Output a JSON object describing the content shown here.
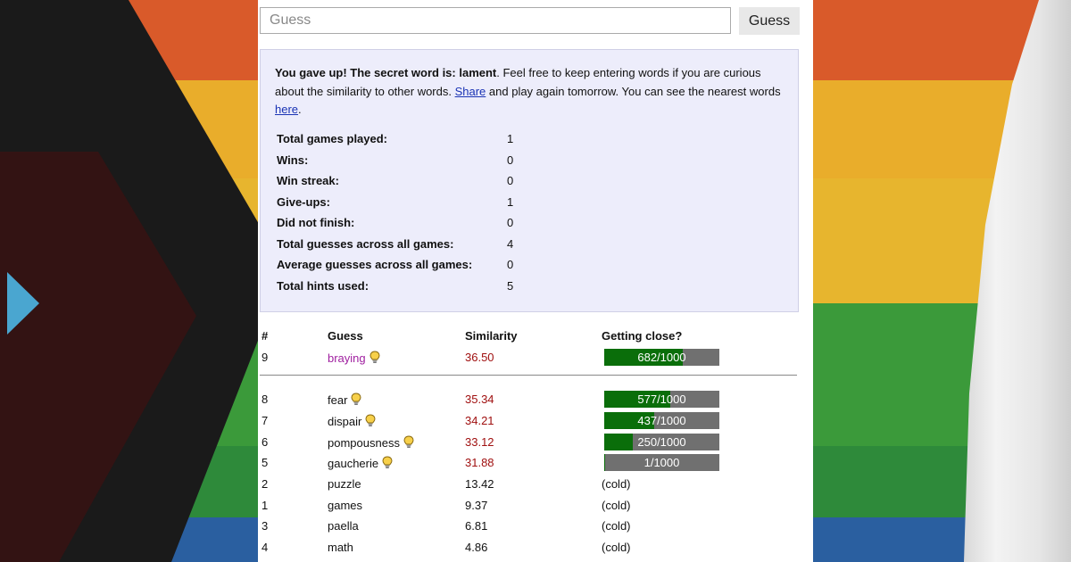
{
  "guess": {
    "placeholder": "Guess",
    "button": "Guess"
  },
  "result": {
    "gave_up_bold": "You gave up! The secret word is: lament",
    "text_1": ". Feel free to keep entering words if you are curious about the similarity to other words. ",
    "share_link": "Share",
    "text_2": " and play again tomorrow. You can see the nearest words ",
    "here_link": "here",
    "text_3": "."
  },
  "stats": [
    {
      "label": "Total games played:",
      "value": "1"
    },
    {
      "label": "Wins:",
      "value": "0"
    },
    {
      "label": "Win streak:",
      "value": "0"
    },
    {
      "label": "Give-ups:",
      "value": "1"
    },
    {
      "label": "Did not finish:",
      "value": "0"
    },
    {
      "label": "Total guesses across all games:",
      "value": "4"
    },
    {
      "label": "Average guesses across all games:",
      "value": "0"
    },
    {
      "label": "Total hints used:",
      "value": "5"
    }
  ],
  "table": {
    "headers": {
      "num": "#",
      "guess": "Guess",
      "similarity": "Similarity",
      "close": "Getting close?"
    },
    "latest": {
      "num": "9",
      "word": "braying",
      "similarity": "36.50",
      "close": "682/1000",
      "progress": 0.682,
      "hint": true
    },
    "rows": [
      {
        "num": "8",
        "word": "fear",
        "similarity": "35.34",
        "close": "577/1000",
        "progress": 0.577,
        "hint": true
      },
      {
        "num": "7",
        "word": "dispair",
        "similarity": "34.21",
        "close": "437/1000",
        "progress": 0.437,
        "hint": true
      },
      {
        "num": "6",
        "word": "pompousness",
        "similarity": "33.12",
        "close": "250/1000",
        "progress": 0.25,
        "hint": true
      },
      {
        "num": "5",
        "word": "gaucherie",
        "similarity": "31.88",
        "close": "1/1000",
        "progress": 0.001,
        "hint": true
      },
      {
        "num": "2",
        "word": "puzzle",
        "similarity": "13.42",
        "close": "(cold)"
      },
      {
        "num": "1",
        "word": "games",
        "similarity": "9.37",
        "close": "(cold)"
      },
      {
        "num": "3",
        "word": "paella",
        "similarity": "6.81",
        "close": "(cold)"
      },
      {
        "num": "4",
        "word": "math",
        "similarity": "4.86",
        "close": "(cold)"
      }
    ]
  },
  "colors": {
    "bar_fill": "#0a6e0a",
    "bar_bg": "#707070",
    "latest_word": "#a020a0",
    "hot_similarity": "#a01010"
  }
}
